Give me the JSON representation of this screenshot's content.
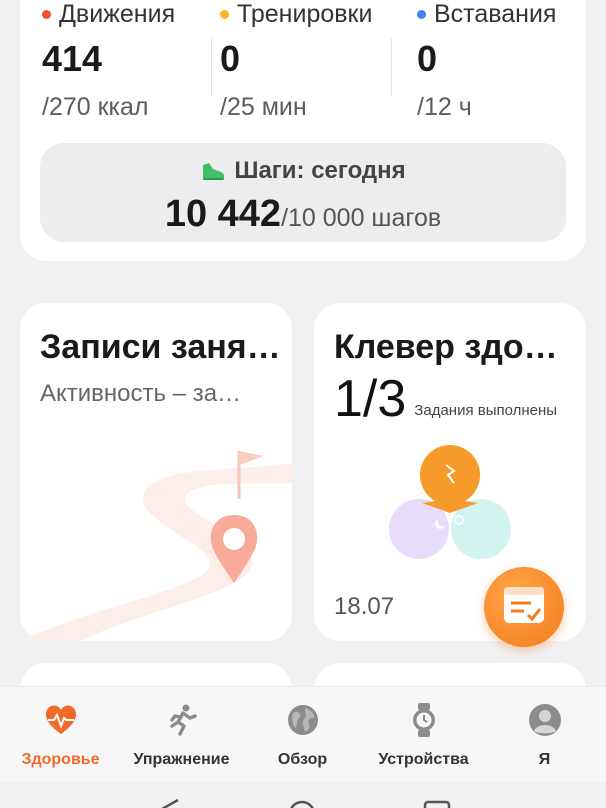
{
  "activity": {
    "rings": [
      {
        "label": "Движения",
        "value": "414",
        "goal": "/270 ккал",
        "color": "#f0512f"
      },
      {
        "label": "Тренировки",
        "value": "0",
        "goal": "/25 мин",
        "color": "#f5b71f"
      },
      {
        "label": "Вставания",
        "value": "0",
        "goal": "/12 ч",
        "color": "#3f84ee"
      }
    ],
    "steps": {
      "title": "Шаги: сегодня",
      "value": "10 442",
      "goal": "/10 000 шагов",
      "icon": "shoe-icon"
    }
  },
  "records": {
    "title": "Записи заня…",
    "subtitle": "Активность – за…"
  },
  "clover": {
    "title": "Клевер здо…",
    "count": "1/3",
    "subtitle": "Задания выполнены",
    "date": "18.07"
  },
  "nav": {
    "items": [
      {
        "label": "Здоровье",
        "icon": "heart-icon",
        "active": true
      },
      {
        "label": "Упражнение",
        "icon": "runner-icon",
        "active": false
      },
      {
        "label": "Обзор",
        "icon": "globe-icon",
        "active": false
      },
      {
        "label": "Устройства",
        "icon": "watch-icon",
        "active": false
      },
      {
        "label": "Я",
        "icon": "profile-icon",
        "active": false
      }
    ]
  },
  "colors": {
    "accent": "#f06a2a",
    "card": "#ffffff",
    "background": "#f1f1f3"
  }
}
